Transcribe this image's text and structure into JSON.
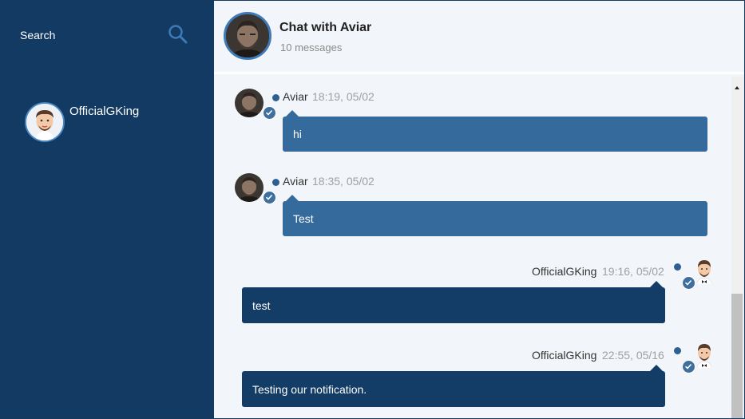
{
  "sidebar": {
    "search": {
      "label": "Search",
      "icon": "search-icon"
    },
    "contacts": [
      {
        "name": "OfficialGKing",
        "icon": "cartoon-man-avatar"
      }
    ]
  },
  "chat": {
    "title": "Chat with Aviar",
    "subtitle": "10 messages",
    "messages": [
      {
        "sender": "Aviar",
        "time": "18:19, 05/02",
        "text": "hi",
        "direction": "incoming"
      },
      {
        "sender": "Aviar",
        "time": "18:35, 05/02",
        "text": "Test",
        "direction": "incoming"
      },
      {
        "sender": "OfficialGKing",
        "time": "19:16, 05/02",
        "text": "test",
        "direction": "outgoing"
      },
      {
        "sender": "OfficialGKing",
        "time": "22:55, 05/16",
        "text": "Testing our notification.",
        "direction": "outgoing"
      }
    ]
  },
  "colors": {
    "sidebar_bg": "#123a63",
    "incoming_bubble": "#356a9c",
    "outgoing_bubble": "#133d66",
    "chat_bg": "#f2f5f9",
    "avatar_ring": "#3f7ab8"
  }
}
